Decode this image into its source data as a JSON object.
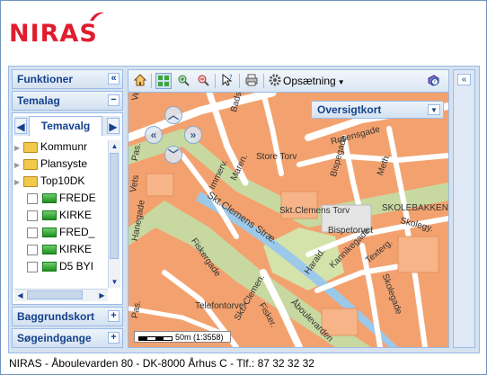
{
  "brand": {
    "logo_text": "NIRAS",
    "color": "#e01c2e"
  },
  "left_panel": {
    "funktioner": {
      "label": "Funktioner",
      "button": "«"
    },
    "temalag": {
      "label": "Temalag",
      "button": "−",
      "tab_label": "Temavalg",
      "tab_prev": "◀",
      "tab_next": "▶",
      "tree": [
        {
          "type": "folder",
          "label": "Kommunr"
        },
        {
          "type": "folder",
          "label": "Plansyste"
        },
        {
          "type": "folder",
          "label": "Top10DK"
        },
        {
          "type": "layer",
          "label": "FREDE"
        },
        {
          "type": "layer",
          "label": "KIRKE"
        },
        {
          "type": "layer",
          "label": "FRED_"
        },
        {
          "type": "layer",
          "label": "KIRKE"
        },
        {
          "type": "layer",
          "label": "D5 BYI"
        }
      ]
    },
    "baggrundskort": {
      "label": "Baggrundskort",
      "button": "+"
    },
    "soegeindgange": {
      "label": "Søgeindgange",
      "button": "+"
    }
  },
  "toolbar": {
    "icons": [
      "home-icon",
      "full-extent-icon",
      "zoom-in-icon",
      "zoom-out-icon",
      "identify-icon",
      "print-icon",
      "settings-icon",
      "help-icon"
    ],
    "settings_label": "Opsætning"
  },
  "map": {
    "overview_label": "Oversigtkort",
    "overview_button": "▼",
    "scale_text": "50m (1:3558)",
    "streets": [
      "Vesterg.",
      "Badstuegade",
      "Rosensgade",
      "Store Torv",
      "Immerv.",
      "Maren.",
      "Bispegade",
      "Meth.",
      "Skt.Clemens Stræ.",
      "Skt.Clemens Torv",
      "Bispetorvet",
      "SKOLEBAKKEN S",
      "Skolegy.",
      "Fiskergade",
      "Kannikegade",
      "Texterg.",
      "Harald.",
      "Skolegade",
      "Telefontorvet",
      "Skt. Clemen.",
      "Fisker.",
      "Åboulevarden",
      "Vets",
      "Pas.",
      "Hanegade",
      "Pas."
    ]
  },
  "right_panel": {
    "button": "«"
  },
  "footer": {
    "text": "NIRAS - Åboulevarden 80 - DK-8000 Århus C - Tlf.: 87 32 32 32"
  }
}
